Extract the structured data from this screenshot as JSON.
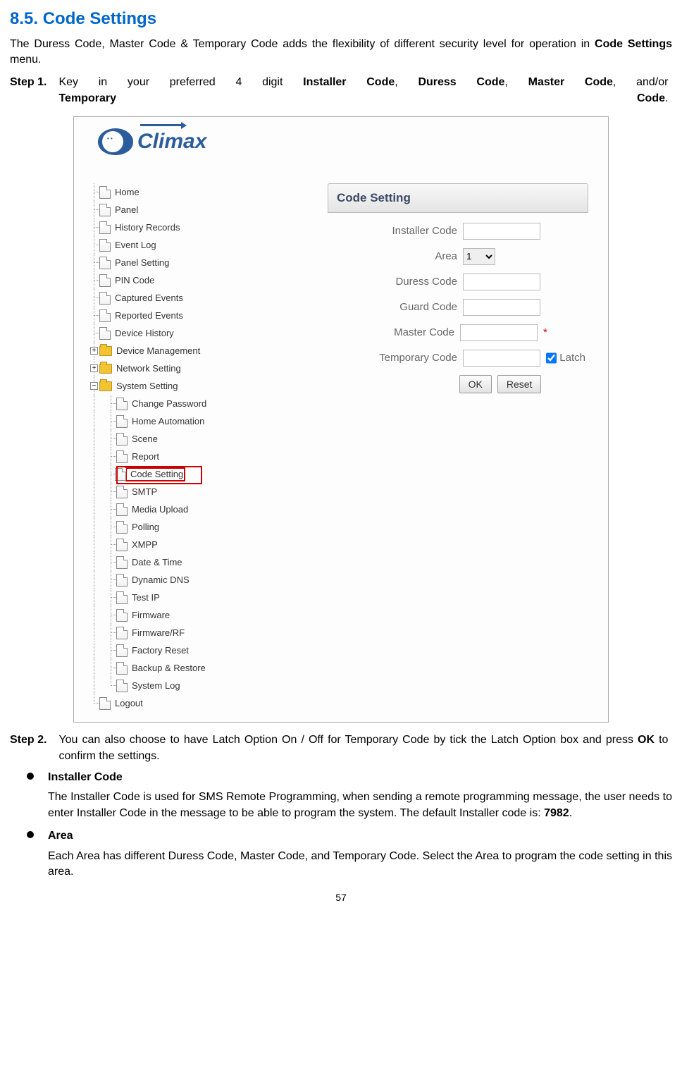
{
  "section": {
    "title": "8.5. Code Settings",
    "intro": "The Duress Code, Master Code & Temporary Code adds the flexibility of different security level for operation in ",
    "intro_bold": "Code Settings",
    "intro_tail": " menu."
  },
  "step1": {
    "label": "Step 1.",
    "body1": "Key in your preferred 4 digit ",
    "b1": "Installer Code",
    "s1": ", ",
    "b2": "Duress Code",
    "s2": ", ",
    "b3": "Master Code",
    "s3": ", and/or ",
    "b4": "Temporary Code",
    "tail": "."
  },
  "step2": {
    "label": "Step 2.",
    "body1": "You can also choose to have Latch Option On / Off for Temporary Code by tick the Latch Option box and press ",
    "bold": "OK",
    "body2": " to confirm the settings."
  },
  "bullet1": {
    "title": "Installer Code",
    "body1": "The Installer Code is used for SMS Remote Programming, when sending a remote programming message, the user needs to enter Installer Code in the message to be able to program the system. The default Installer code is: ",
    "bold": "7982",
    "tail": "."
  },
  "bullet2": {
    "title": "Area",
    "body": "Each Area has different Duress Code, Master Code, and Temporary Code. Select the Area to program the code setting in this area."
  },
  "page_number": "57",
  "screenshot": {
    "logo": "Climax",
    "panel_title": "Code Setting",
    "labels": {
      "installer": "Installer Code",
      "area": "Area",
      "duress": "Duress Code",
      "guard": "Guard Code",
      "master": "Master Code",
      "temporary": "Temporary Code",
      "latch": "Latch"
    },
    "area_option": "1",
    "buttons": {
      "ok": "OK",
      "reset": "Reset"
    },
    "tree": {
      "top_items": [
        "Home",
        "Panel",
        "History Records",
        "Event Log",
        "Panel Setting",
        "PIN Code",
        "Captured Events",
        "Reported Events",
        "Device History"
      ],
      "folders": [
        {
          "label": "Device Management",
          "sign": "+"
        },
        {
          "label": "Network Setting",
          "sign": "+"
        },
        {
          "label": "System Setting",
          "sign": "−"
        }
      ],
      "system_items": [
        "Change Password",
        "Home Automation",
        "Scene",
        "Report",
        "Code Setting",
        "SMTP",
        "Media Upload",
        "Polling",
        "XMPP",
        "Date & Time",
        "Dynamic DNS",
        "Test IP",
        "Firmware",
        "Firmware/RF",
        "Factory Reset",
        "Backup & Restore",
        "System Log"
      ],
      "logout": "Logout"
    }
  }
}
